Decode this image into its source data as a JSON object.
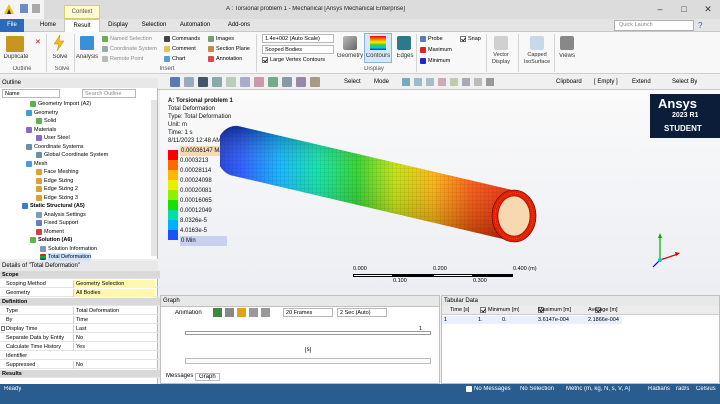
{
  "window": {
    "title": "A : Torsional problem 1 - Mechanical [Ansys Mechanical Enterprise]",
    "context_label": "Context"
  },
  "tabs": [
    "File",
    "Home",
    "Result",
    "Display",
    "Selection",
    "Automation",
    "Add-ons"
  ],
  "search": {
    "placeholder": "Quick Launch"
  },
  "ribbon": {
    "outline": {
      "duplicate": "Duplicate",
      "group": "Outline"
    },
    "solve": {
      "label": "Solve",
      "group": "Solve"
    },
    "analysis": "Analysis",
    "named_selection": "Named Selection",
    "coordinate_system": "Coordinate System",
    "remote_point": "Remote Point",
    "commands": "Commands",
    "comment": "Comment",
    "chart": "Chart",
    "images": "Images",
    "section_plane": "Section Plane",
    "annotation": "Annotation",
    "insert_group": "Insert",
    "scale": "1.4e+002 (Auto Scale)",
    "scoped_bodies": "Scoped Bodies",
    "large_vertex": "Large Vertex Contours",
    "geometry": "Geometry",
    "contours": "Contours",
    "edges": "Edges",
    "display_group": "Display",
    "probe": "Probe",
    "snap": "Snap",
    "maximum": "Maximum",
    "minimum": "Minimum",
    "vector_display": "Vector Display",
    "capped_isosurface": "Capped IsoSurface",
    "views": "Views"
  },
  "toolbar": {
    "select": "Select",
    "mode": "Mode",
    "clipboard": "Clipboard",
    "empty": "[ Empty ]",
    "extend": "Extend",
    "select_by": "Select By"
  },
  "outline_panel": {
    "title": "Outline",
    "filter": "Name",
    "search": "Search Outline",
    "tree": [
      {
        "label": "Geometry Import (A2)"
      },
      {
        "label": "Geometry"
      },
      {
        "label": "Solid"
      },
      {
        "label": "Materials"
      },
      {
        "label": "User Steel"
      },
      {
        "label": "Coordinate Systems"
      },
      {
        "label": "Global Coordinate System"
      },
      {
        "label": "Mesh"
      },
      {
        "label": "Face Meshing"
      },
      {
        "label": "Edge Sizing"
      },
      {
        "label": "Edge Sizing 2"
      },
      {
        "label": "Edge Sizing 3"
      },
      {
        "label": "Static Structural (A5)"
      },
      {
        "label": "Analysis Settings"
      },
      {
        "label": "Fixed Support"
      },
      {
        "label": "Moment"
      },
      {
        "label": "Solution (A6)"
      },
      {
        "label": "Solution Information"
      },
      {
        "label": "Total Deformation"
      }
    ]
  },
  "details": {
    "title": "Details of \"Total Deformation\"",
    "rows": [
      {
        "k": "Scope",
        "v": "",
        "hdr": true
      },
      {
        "k": "Scoping Method",
        "v": "Geometry Selection"
      },
      {
        "k": "Geometry",
        "v": "All Bodies"
      },
      {
        "k": "Definition",
        "v": "",
        "hdr": true
      },
      {
        "k": "Type",
        "v": "Total Deformation"
      },
      {
        "k": "By",
        "v": "Time"
      },
      {
        "k": "Display Time",
        "v": "Last"
      },
      {
        "k": "Separate Data by Entity",
        "v": "No"
      },
      {
        "k": "Calculate Time History",
        "v": "Yes"
      },
      {
        "k": "Identifier",
        "v": ""
      },
      {
        "k": "Suppressed",
        "v": "No"
      },
      {
        "k": "Results",
        "v": "",
        "hdr": true
      }
    ]
  },
  "viewport": {
    "info": [
      "A: Torsional problem 1",
      "Total Deformation",
      "Type: Total Deformation",
      "Unit: m",
      "Time: 1 s",
      "8/11/2023 12:48 AM"
    ],
    "legend": [
      "0.00036147 Max",
      "0.0003213",
      "0.00028114",
      "0.00024098",
      "0.00020081",
      "0.00016065",
      "0.00012049",
      "8.0326e-5",
      "4.0163e-5",
      "0 Min"
    ],
    "legend_colors": [
      "#ff0000",
      "#ff6a00",
      "#ffb800",
      "#e8f000",
      "#8ff000",
      "#16e000",
      "#00e0a0",
      "#00b0ff",
      "#1a50ff",
      "#0000d0"
    ],
    "scale_top": [
      "0.000",
      "0.200",
      "0.400 (m)"
    ],
    "scale_bottom": [
      "0.100",
      "0.300"
    ],
    "brand": "Ansys",
    "version": "2023 R1",
    "edition": "STUDENT"
  },
  "graph": {
    "title": "Graph",
    "animation": "Animation",
    "frames": "20 Frames",
    "sec": "2 Sec (Auto)",
    "axis_label": "[s]",
    "tick": "1",
    "tabs": [
      "Messages",
      "Graph"
    ]
  },
  "tabular": {
    "title": "Tabular Data",
    "headers": [
      "Time [s]",
      "Minimum [m]",
      "Maximum [m]",
      "Average [m]"
    ],
    "rows": [
      [
        "1",
        "1.",
        "0.",
        "3.6147e-004",
        "2.1866e-004"
      ]
    ]
  },
  "status": {
    "ready": "Ready",
    "messages": "No Messages",
    "selection": "No Selection",
    "units": "Metric (m, kg, N, s, V, A)",
    "radians": "Radians",
    "rads": "rad/s",
    "celsius": "Celsius"
  }
}
